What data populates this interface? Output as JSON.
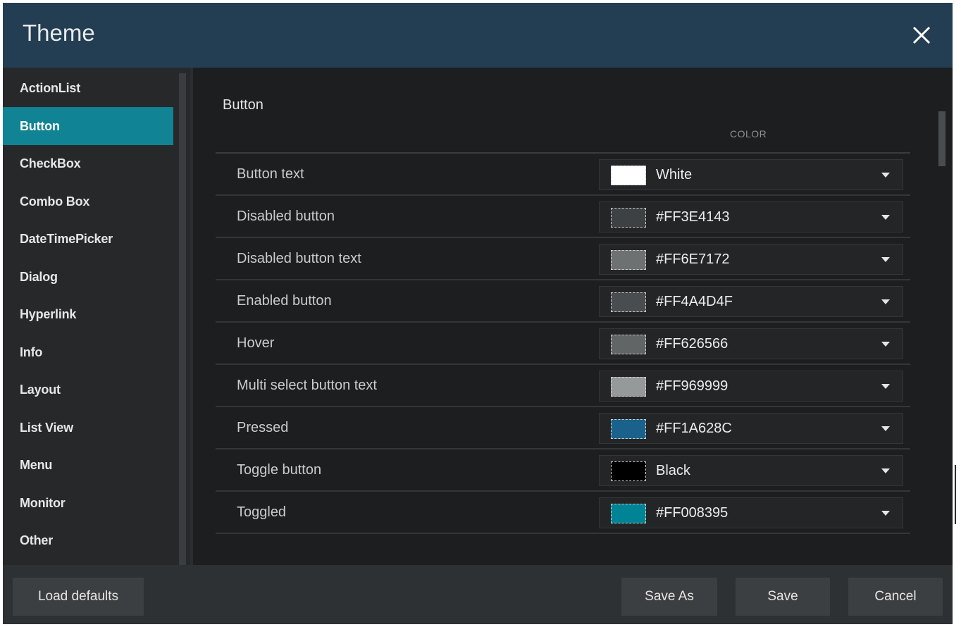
{
  "window": {
    "title": "Theme",
    "close_icon": "close-icon"
  },
  "sidebar": {
    "selected": "Button",
    "items": [
      {
        "label": "ActionList"
      },
      {
        "label": "Button"
      },
      {
        "label": "CheckBox"
      },
      {
        "label": "Combo Box"
      },
      {
        "label": "DateTimePicker"
      },
      {
        "label": "Dialog"
      },
      {
        "label": "Hyperlink"
      },
      {
        "label": "Info"
      },
      {
        "label": "Layout"
      },
      {
        "label": "List View"
      },
      {
        "label": "Menu"
      },
      {
        "label": "Monitor"
      },
      {
        "label": "Other"
      }
    ]
  },
  "main": {
    "section_title": "Button",
    "column_header": "COLOR",
    "rows": [
      {
        "label": "Button text",
        "value": "White",
        "color": "#FFFFFF"
      },
      {
        "label": "Disabled button",
        "value": "#FF3E4143",
        "color": "#3E4143"
      },
      {
        "label": "Disabled button text",
        "value": "#FF6E7172",
        "color": "#6E7172"
      },
      {
        "label": "Enabled button",
        "value": "#FF4A4D4F",
        "color": "#4A4D4F"
      },
      {
        "label": "Hover",
        "value": "#FF626566",
        "color": "#626566"
      },
      {
        "label": "Multi select button text",
        "value": "#FF969999",
        "color": "#969999"
      },
      {
        "label": "Pressed",
        "value": "#FF1A628C",
        "color": "#1A628C"
      },
      {
        "label": "Toggle button",
        "value": "Black",
        "color": "#000000"
      },
      {
        "label": "Toggled",
        "value": "#FF008395",
        "color": "#008395"
      }
    ]
  },
  "footer": {
    "load_defaults": "Load defaults",
    "save_as": "Save As",
    "save": "Save",
    "cancel": "Cancel"
  },
  "colors": {
    "titlebar": "#233E52",
    "accent": "#108394",
    "background": "#1C1E20"
  }
}
